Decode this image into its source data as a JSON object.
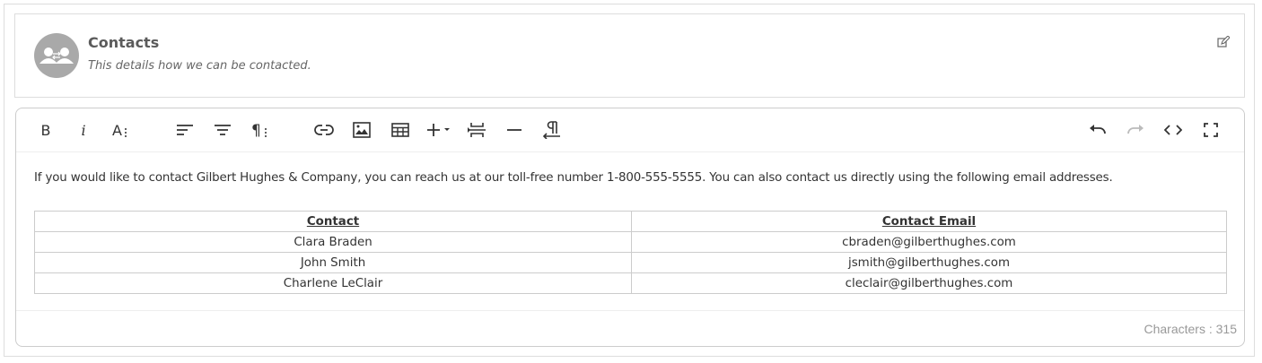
{
  "header": {
    "title": "Contacts",
    "subtitle": "This details how we can be contacted.",
    "avatar_icon": "contacts-exchange-icon",
    "edit_icon": "edit-icon"
  },
  "toolbar": {
    "buttons": [
      {
        "name": "bold",
        "label": "B",
        "icon": "bold-icon"
      },
      {
        "name": "italic",
        "label": "i",
        "icon": "italic-icon"
      },
      {
        "name": "font-size",
        "label": "A",
        "icon": "font-size-icon"
      },
      {
        "name": "align",
        "icon": "align-left-icon"
      },
      {
        "name": "formats",
        "icon": "formats-icon"
      },
      {
        "name": "paragraph",
        "icon": "paragraph-icon"
      },
      {
        "name": "link",
        "icon": "link-icon"
      },
      {
        "name": "image",
        "icon": "image-icon"
      },
      {
        "name": "table",
        "icon": "table-icon"
      },
      {
        "name": "insert",
        "icon": "plus-dropdown-icon"
      },
      {
        "name": "page-break",
        "icon": "page-break-icon"
      },
      {
        "name": "horizontal-line",
        "icon": "horizontal-line-icon"
      },
      {
        "name": "text-direction",
        "icon": "rtl-paragraph-icon"
      },
      {
        "name": "undo",
        "icon": "undo-icon"
      },
      {
        "name": "redo",
        "icon": "redo-icon",
        "disabled": true
      },
      {
        "name": "code-view",
        "icon": "code-icon"
      },
      {
        "name": "fullscreen",
        "icon": "fullscreen-icon"
      }
    ]
  },
  "content": {
    "paragraph": "If you would like to contact Gilbert Hughes & Company, you can reach us at our toll-free number 1-800-555-5555. You can also contact us directly using the following email addresses.",
    "table": {
      "headers": [
        "Contact",
        "Contact Email"
      ],
      "rows": [
        [
          "Clara Braden",
          "cbraden@gilberthughes.com"
        ],
        [
          "John Smith",
          "jsmith@gilberthughes.com"
        ],
        [
          "Charlene LeClair",
          "cleclair@gilberthughes.com"
        ]
      ]
    }
  },
  "footer": {
    "char_count": "Characters : 315"
  },
  "colors": {
    "avatar_bg": "#a9a9a9",
    "border": "#dddddd",
    "muted_text": "#999999"
  }
}
